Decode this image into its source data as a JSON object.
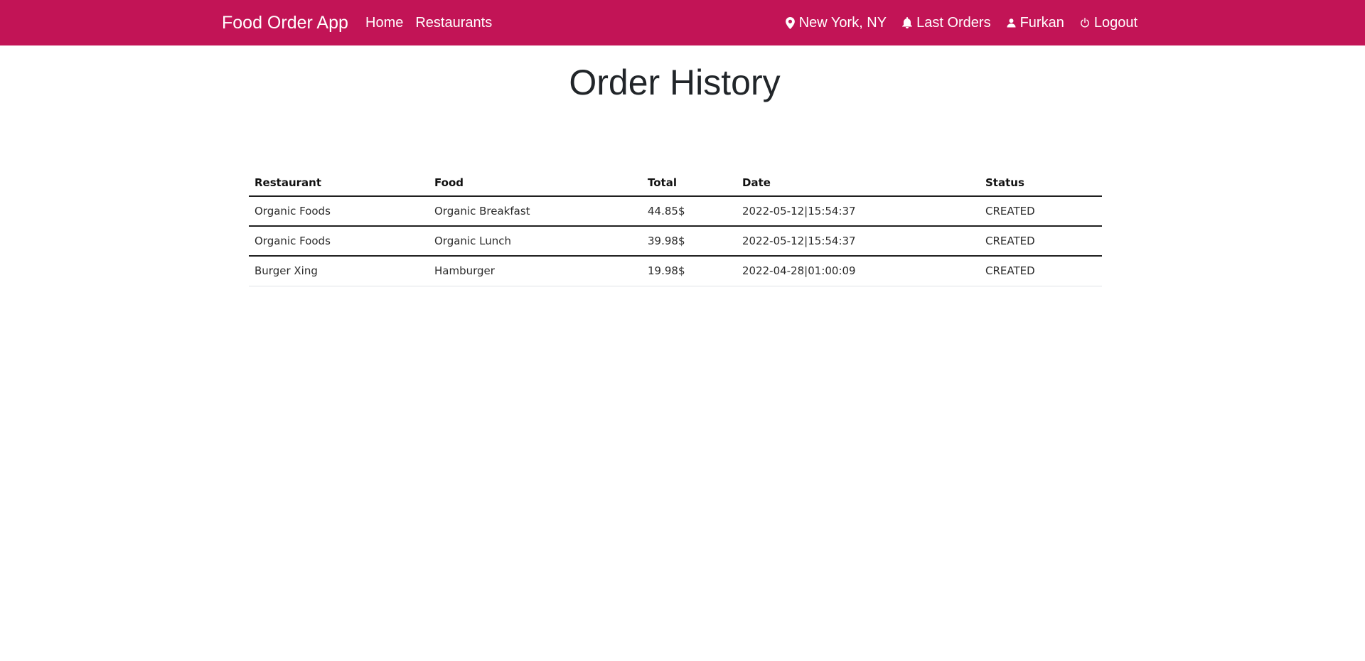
{
  "nav": {
    "brand": "Food Order App",
    "links": [
      {
        "label": "Home"
      },
      {
        "label": "Restaurants"
      }
    ],
    "right": [
      {
        "label": "New York, NY",
        "icon": "location-pin-icon"
      },
      {
        "label": "Last Orders",
        "icon": "bell-icon"
      },
      {
        "label": "Furkan",
        "icon": "person-icon"
      },
      {
        "label": "Logout",
        "icon": "power-icon"
      }
    ],
    "color": "#c21456"
  },
  "page": {
    "title": "Order History"
  },
  "table": {
    "headers": [
      "Restaurant",
      "Food",
      "Total",
      "Date",
      "Status"
    ],
    "rows": [
      [
        "Organic Foods",
        "Organic Breakfast",
        "44.85$",
        "2022-05-12|15:54:37",
        "CREATED"
      ],
      [
        "Organic Foods",
        "Organic Lunch",
        "39.98$",
        "2022-05-12|15:54:37",
        "CREATED"
      ],
      [
        "Burger Xing",
        "Hamburger",
        "19.98$",
        "2022-04-28|01:00:09",
        "CREATED"
      ]
    ]
  }
}
